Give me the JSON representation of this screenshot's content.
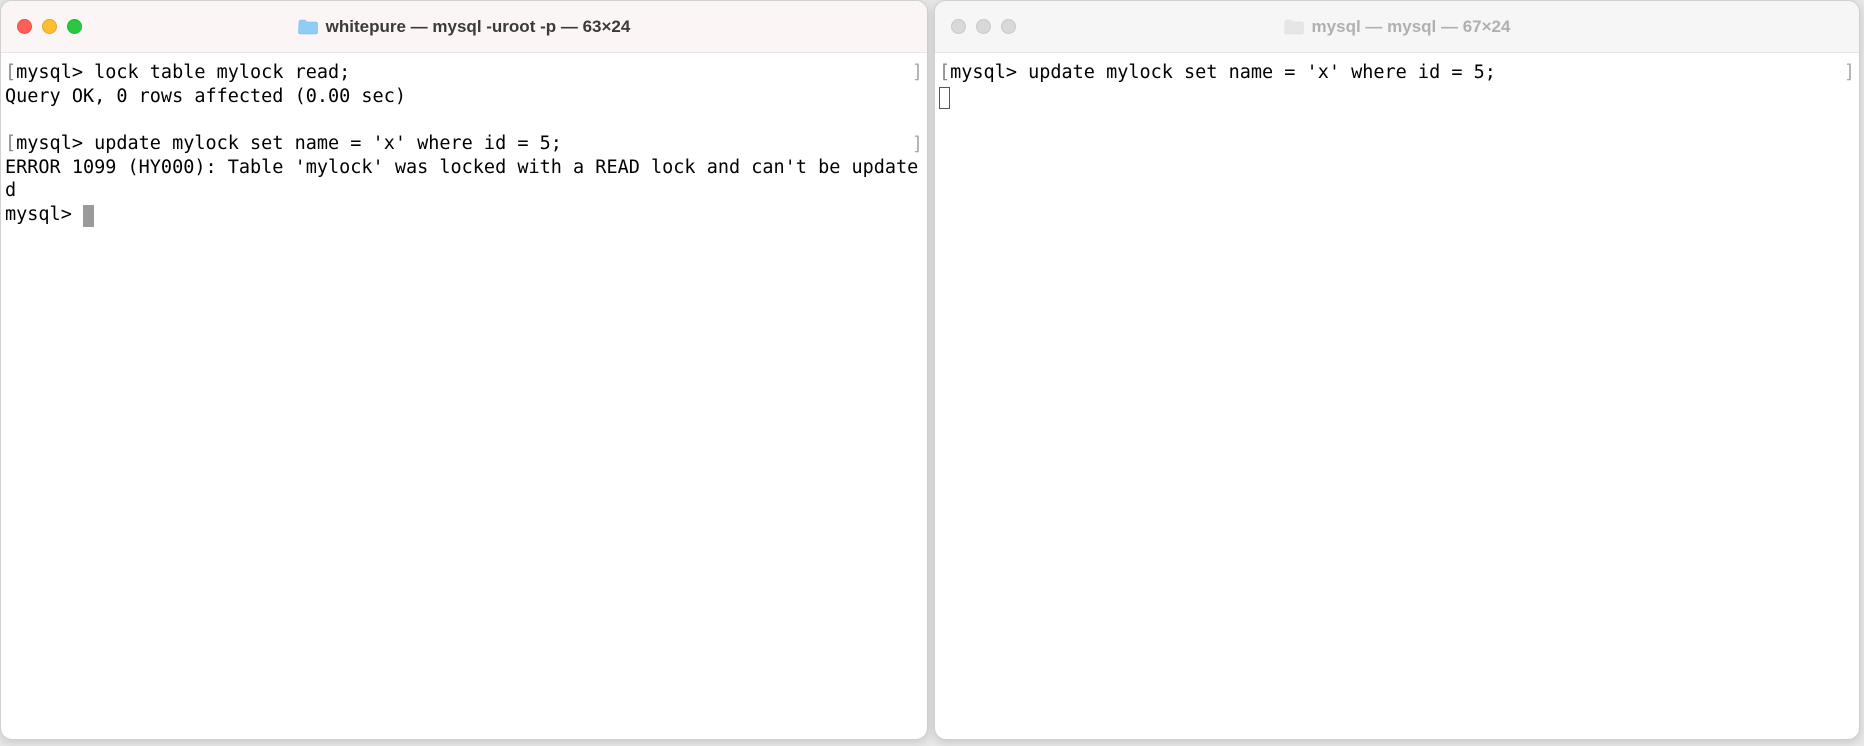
{
  "leftWindow": {
    "title": "whitepure — mysql -uroot -p — 63×24",
    "active": true,
    "lines": {
      "l1_prompt": "mysql>",
      "l1_text": " lock table mylock read;",
      "l2_text": "Query OK, 0 rows affected (0.00 sec)",
      "l3_text": "",
      "l4_prompt": "mysql>",
      "l4_text": " update mylock set name = 'x' where id = 5;",
      "l5_text": "ERROR 1099 (HY000): Table 'mylock' was locked with a READ lock and can't be updated",
      "l7_prompt": "mysql> "
    }
  },
  "rightWindow": {
    "title": "mysql — mysql — 67×24",
    "active": false,
    "lines": {
      "l1_prompt": "mysql>",
      "l1_text": " update mylock set name = 'x' where id = 5;"
    }
  }
}
